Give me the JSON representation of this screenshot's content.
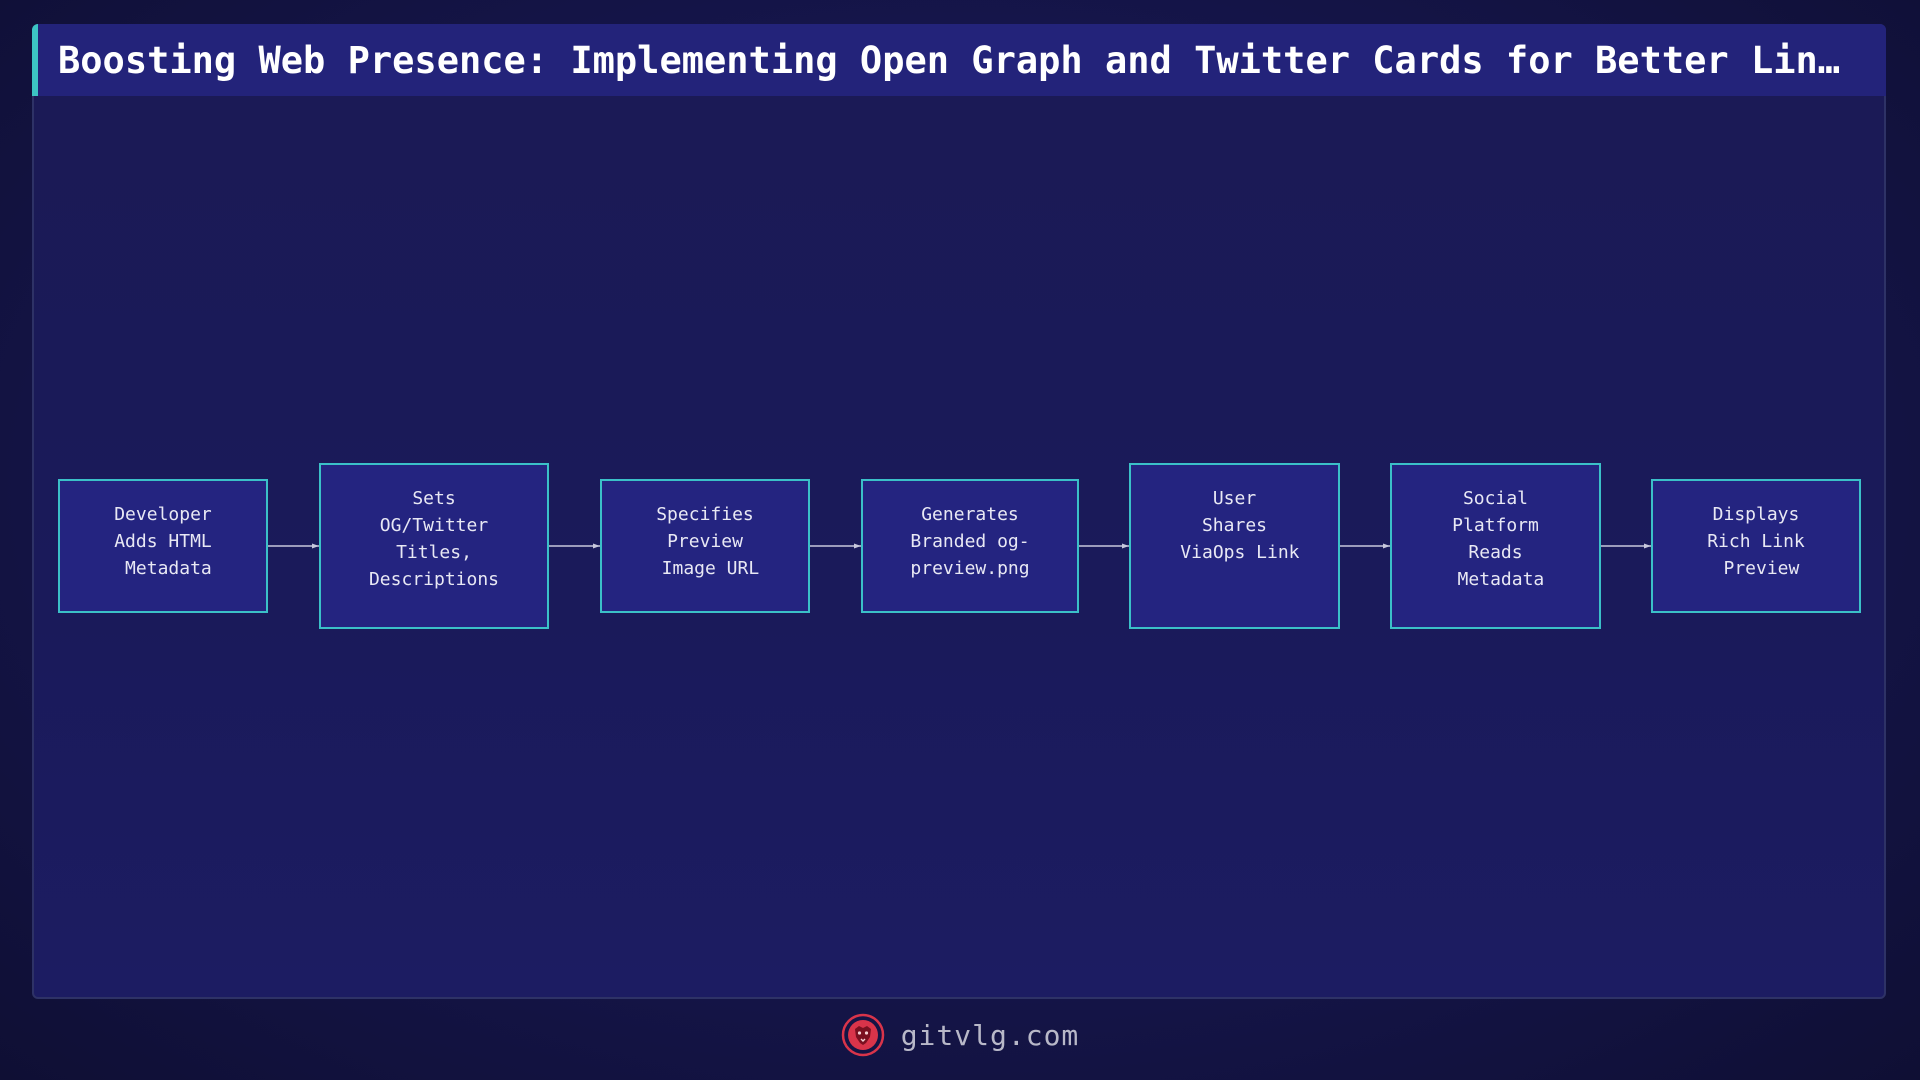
{
  "header": {
    "title": "Boosting Web Presence: Implementing Open Graph and Twitter Cards for Better Lin…"
  },
  "diagram": {
    "type": "flowchart",
    "direction": "left-to-right",
    "nodes": [
      {
        "id": "n1",
        "label": "Developer\nAdds HTML\n Metadata"
      },
      {
        "id": "n2",
        "label": "Sets\nOG/Twitter\nTitles,\nDescriptions"
      },
      {
        "id": "n3",
        "label": "Specifies\nPreview\n Image URL"
      },
      {
        "id": "n4",
        "label": "Generates\nBranded og-\npreview.png"
      },
      {
        "id": "n5",
        "label": "User\nShares\n ViaOps Link"
      },
      {
        "id": "n6",
        "label": "Social\nPlatform\nReads\n Metadata"
      },
      {
        "id": "n7",
        "label": "Displays\nRich Link\n Preview"
      }
    ],
    "edges": [
      {
        "from": "n1",
        "to": "n2"
      },
      {
        "from": "n2",
        "to": "n3"
      },
      {
        "from": "n3",
        "to": "n4"
      },
      {
        "from": "n4",
        "to": "n5"
      },
      {
        "from": "n5",
        "to": "n6"
      },
      {
        "from": "n6",
        "to": "n7"
      }
    ]
  },
  "footer": {
    "site": "gitvlg.com",
    "logo_icon": "lion-head-icon"
  },
  "colors": {
    "background": "#15154a",
    "title_bar": "#23237a",
    "title_accent": "#3cc4c4",
    "node_fill": "#242480",
    "node_border": "#3bc0c8",
    "edge": "#c8c8dc",
    "logo": "#d9344a"
  }
}
